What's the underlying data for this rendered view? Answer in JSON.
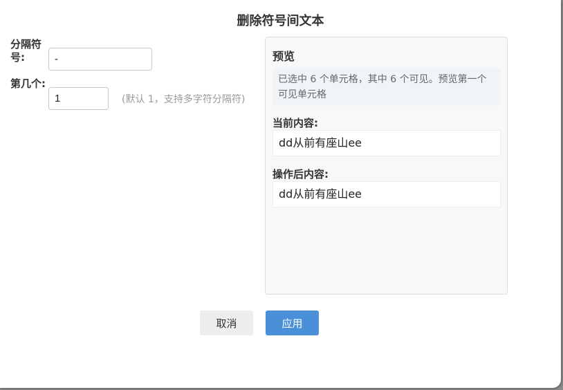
{
  "dialog": {
    "title": "删除符号间文本"
  },
  "form": {
    "separator_label": "分隔符号:",
    "separator_value": "-",
    "index_label": "第几个:",
    "index_value": "1",
    "index_hint": "(默认 1，支持多字符分隔符)"
  },
  "preview": {
    "title": "预览",
    "info": "已选中 6 个单元格，其中 6 个可见。预览第一个可见单元格",
    "current_label": "当前内容:",
    "current_value": "dd从前有座山ee",
    "after_label": "操作后内容:",
    "after_value": "dd从前有座山ee"
  },
  "buttons": {
    "cancel_label": "取消",
    "apply_label": "应用"
  },
  "colors": {
    "apply_button": "#4a90d9",
    "cancel_button": "#eeeeee",
    "panel_background": "#f8f8f8"
  }
}
